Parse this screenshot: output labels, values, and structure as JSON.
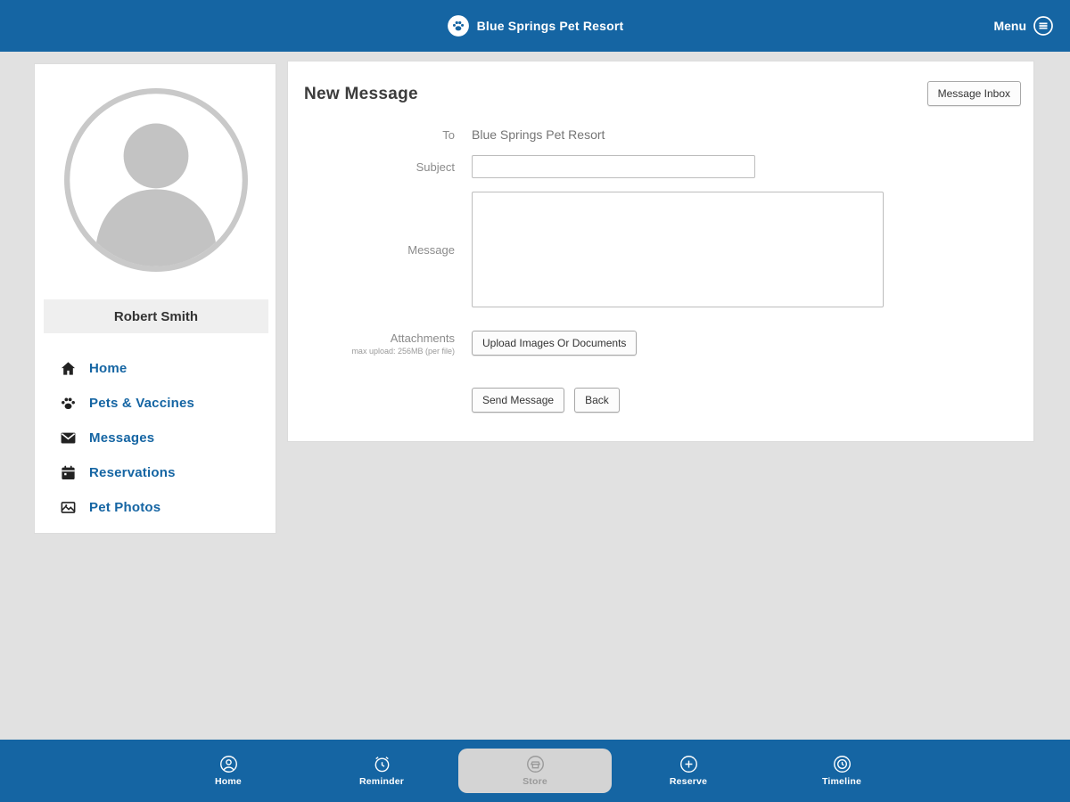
{
  "header": {
    "brand": "Blue Springs Pet Resort",
    "menu_label": "Menu"
  },
  "sidebar": {
    "user_name": "Robert Smith",
    "items": [
      {
        "label": "Home",
        "icon": "home-icon"
      },
      {
        "label": "Pets & Vaccines",
        "icon": "paw-icon"
      },
      {
        "label": "Messages",
        "icon": "envelope-icon"
      },
      {
        "label": "Reservations",
        "icon": "calendar-icon"
      },
      {
        "label": "Pet Photos",
        "icon": "photos-icon"
      }
    ]
  },
  "main": {
    "title": "New Message",
    "inbox_button": "Message Inbox",
    "form": {
      "to_label": "To",
      "to_value": "Blue Springs Pet Resort",
      "subject_label": "Subject",
      "subject_value": "",
      "message_label": "Message",
      "message_value": "",
      "attachments_label": "Attachments",
      "attachments_hint": "max upload: 256MB (per file)",
      "upload_button": "Upload Images Or Documents",
      "send_button": "Send Message",
      "back_button": "Back"
    }
  },
  "footer": {
    "items": [
      {
        "label": "Home",
        "icon": "account-icon",
        "selected": false
      },
      {
        "label": "Reminder",
        "icon": "reminder-icon",
        "selected": false
      },
      {
        "label": "Store",
        "icon": "store-icon",
        "selected": true
      },
      {
        "label": "Reserve",
        "icon": "reserve-plus-icon",
        "selected": false
      },
      {
        "label": "Timeline",
        "icon": "timeline-icon",
        "selected": false
      }
    ]
  },
  "colors": {
    "primary": "#1565a3",
    "link_blue": "#1565a3",
    "page_background": "#e1e1e1"
  }
}
